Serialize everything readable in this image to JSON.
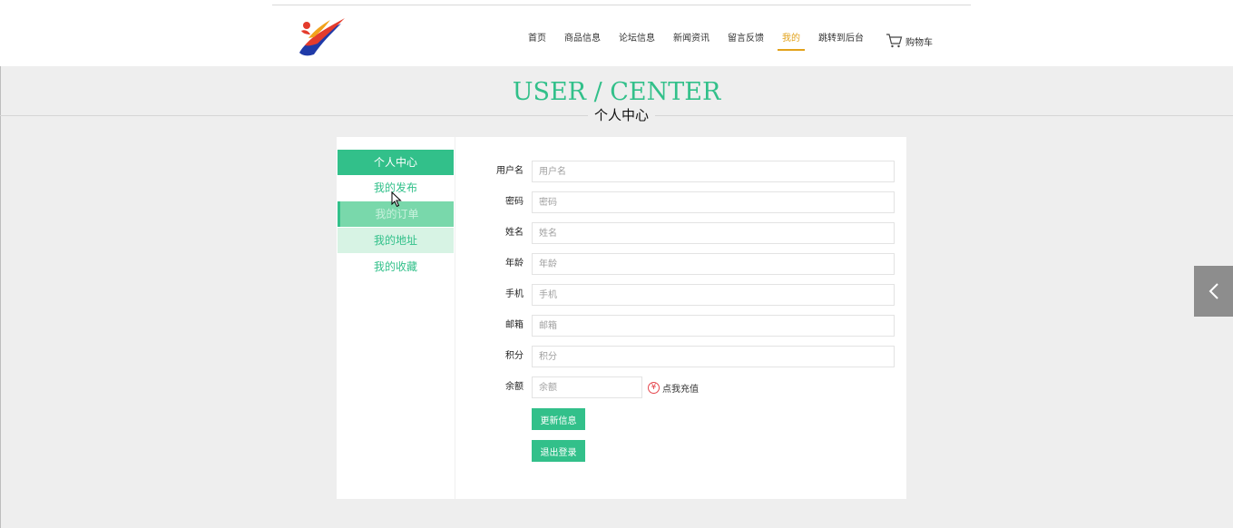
{
  "nav": {
    "items": [
      {
        "label": "首页",
        "active": false
      },
      {
        "label": "商品信息",
        "active": false
      },
      {
        "label": "论坛信息",
        "active": false
      },
      {
        "label": "新闻资讯",
        "active": false
      },
      {
        "label": "留言反馈",
        "active": false
      },
      {
        "label": "我的",
        "active": true
      },
      {
        "label": "跳转到后台",
        "active": false
      }
    ],
    "cart_label": "购物车"
  },
  "title": {
    "en": "USER / CENTER",
    "cn": "个人中心"
  },
  "sidebar": {
    "items": [
      {
        "label": "个人中心",
        "state": "selected"
      },
      {
        "label": "我的发布",
        "state": "normal"
      },
      {
        "label": "我的订单",
        "state": "hover"
      },
      {
        "label": "我的地址",
        "state": "light"
      },
      {
        "label": "我的收藏",
        "state": "normal"
      }
    ]
  },
  "form": {
    "fields": [
      {
        "label": "用户名",
        "placeholder": "用户名",
        "value": ""
      },
      {
        "label": "密码",
        "placeholder": "密码",
        "value": ""
      },
      {
        "label": "姓名",
        "placeholder": "姓名",
        "value": ""
      },
      {
        "label": "年龄",
        "placeholder": "年龄",
        "value": ""
      },
      {
        "label": "手机",
        "placeholder": "手机",
        "value": ""
      },
      {
        "label": "邮箱",
        "placeholder": "邮箱",
        "value": ""
      },
      {
        "label": "积分",
        "placeholder": "积分",
        "value": ""
      },
      {
        "label": "余额",
        "placeholder": "余额",
        "value": ""
      }
    ],
    "recharge_label": "点我充值",
    "recharge_icon": "¥",
    "update_button": "更新信息",
    "logout_button": "退出登录"
  },
  "colors": {
    "accent": "#32c08a",
    "active_nav": "#e2a21b",
    "recharge": "#e5474e"
  }
}
